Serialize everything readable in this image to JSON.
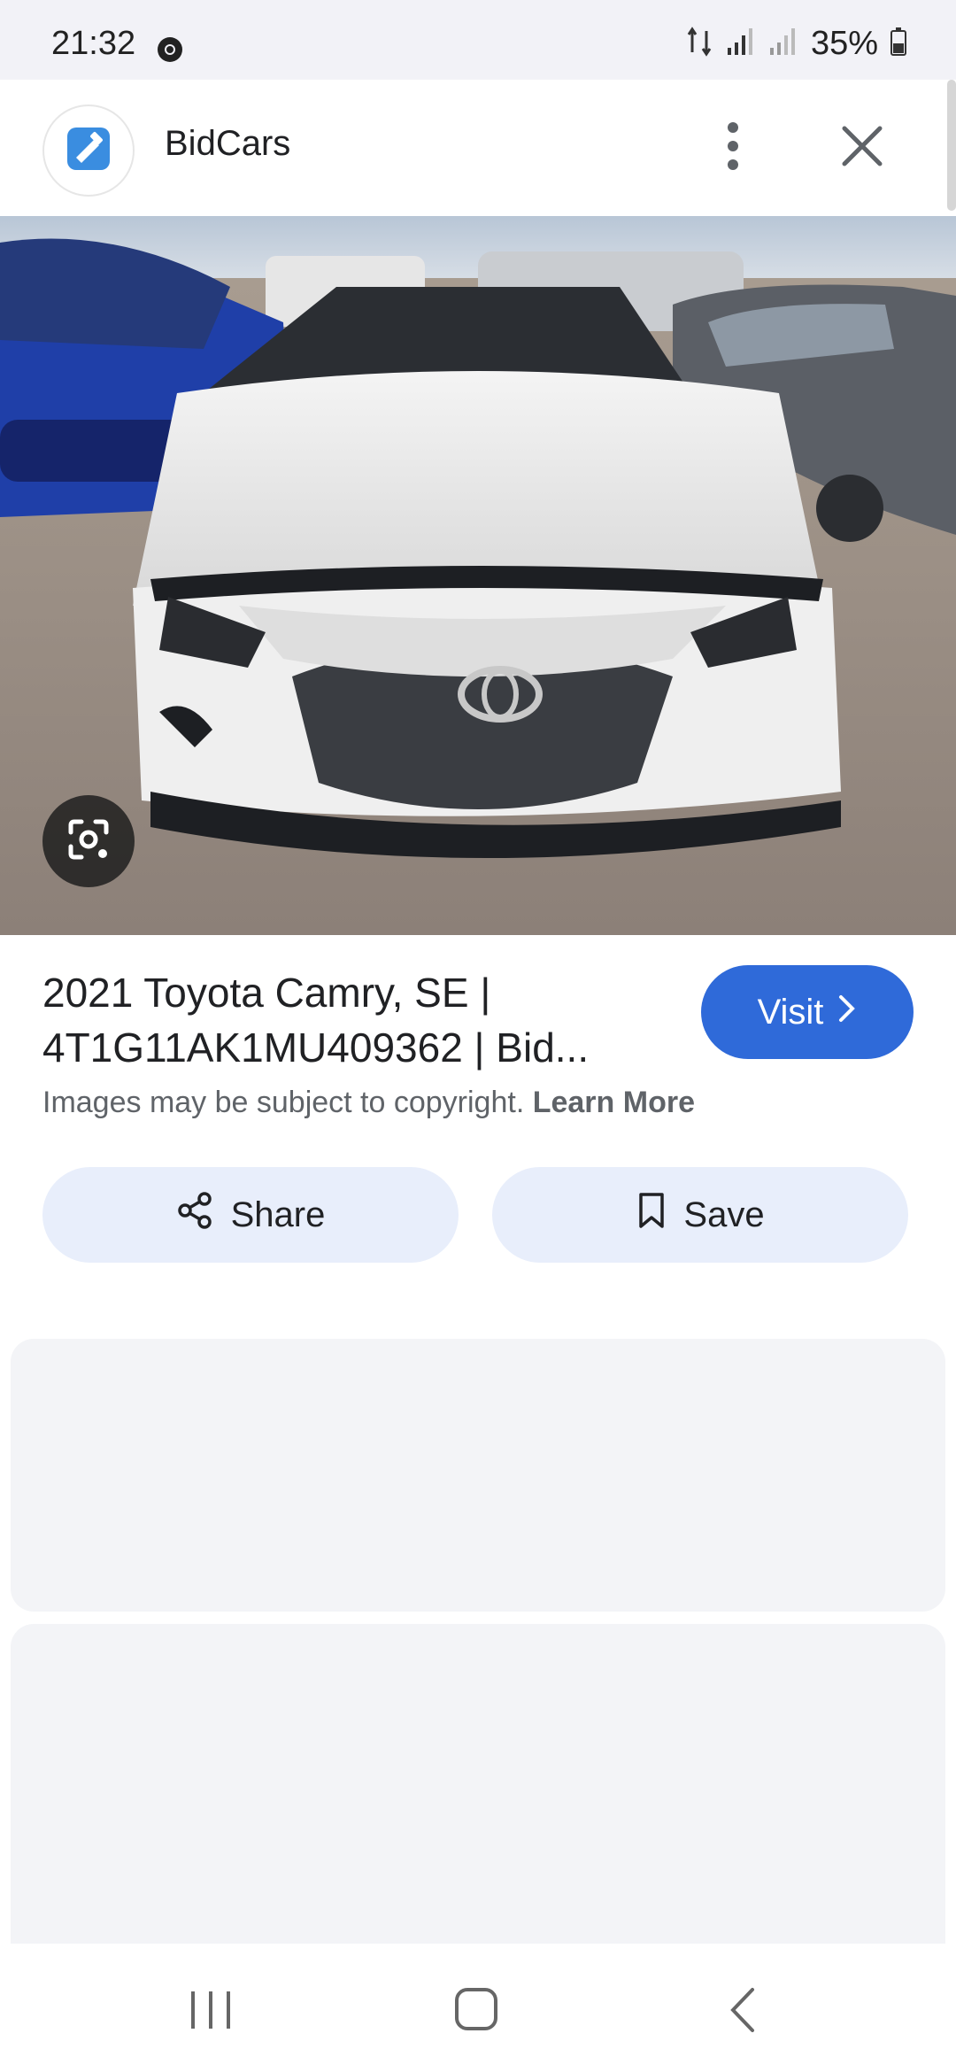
{
  "status_bar": {
    "time": "21:32",
    "battery": "35%"
  },
  "header": {
    "site_name": "BidCars"
  },
  "result": {
    "title_line1": "2021 Toyota Camry, SE |",
    "title_line2": "4T1G11AK1MU409362 | Bid...",
    "visit_label": "Visit",
    "copyright_text": "Images may be subject to copyright.",
    "learn_more": "Learn More",
    "share_label": "Share",
    "save_label": "Save"
  },
  "colors": {
    "accent": "#2f6ad9",
    "pill_bg": "#e8eefb",
    "card_bg": "#f3f4f7"
  },
  "icons": [
    "chrome-icon",
    "data-signal-icon",
    "signal-icon",
    "battery-icon",
    "bidcars-logo-icon",
    "more-vert-icon",
    "close-icon",
    "lens-icon",
    "chevron-right-icon",
    "share-icon",
    "bookmark-icon",
    "recents-icon",
    "home-icon",
    "back-icon"
  ]
}
